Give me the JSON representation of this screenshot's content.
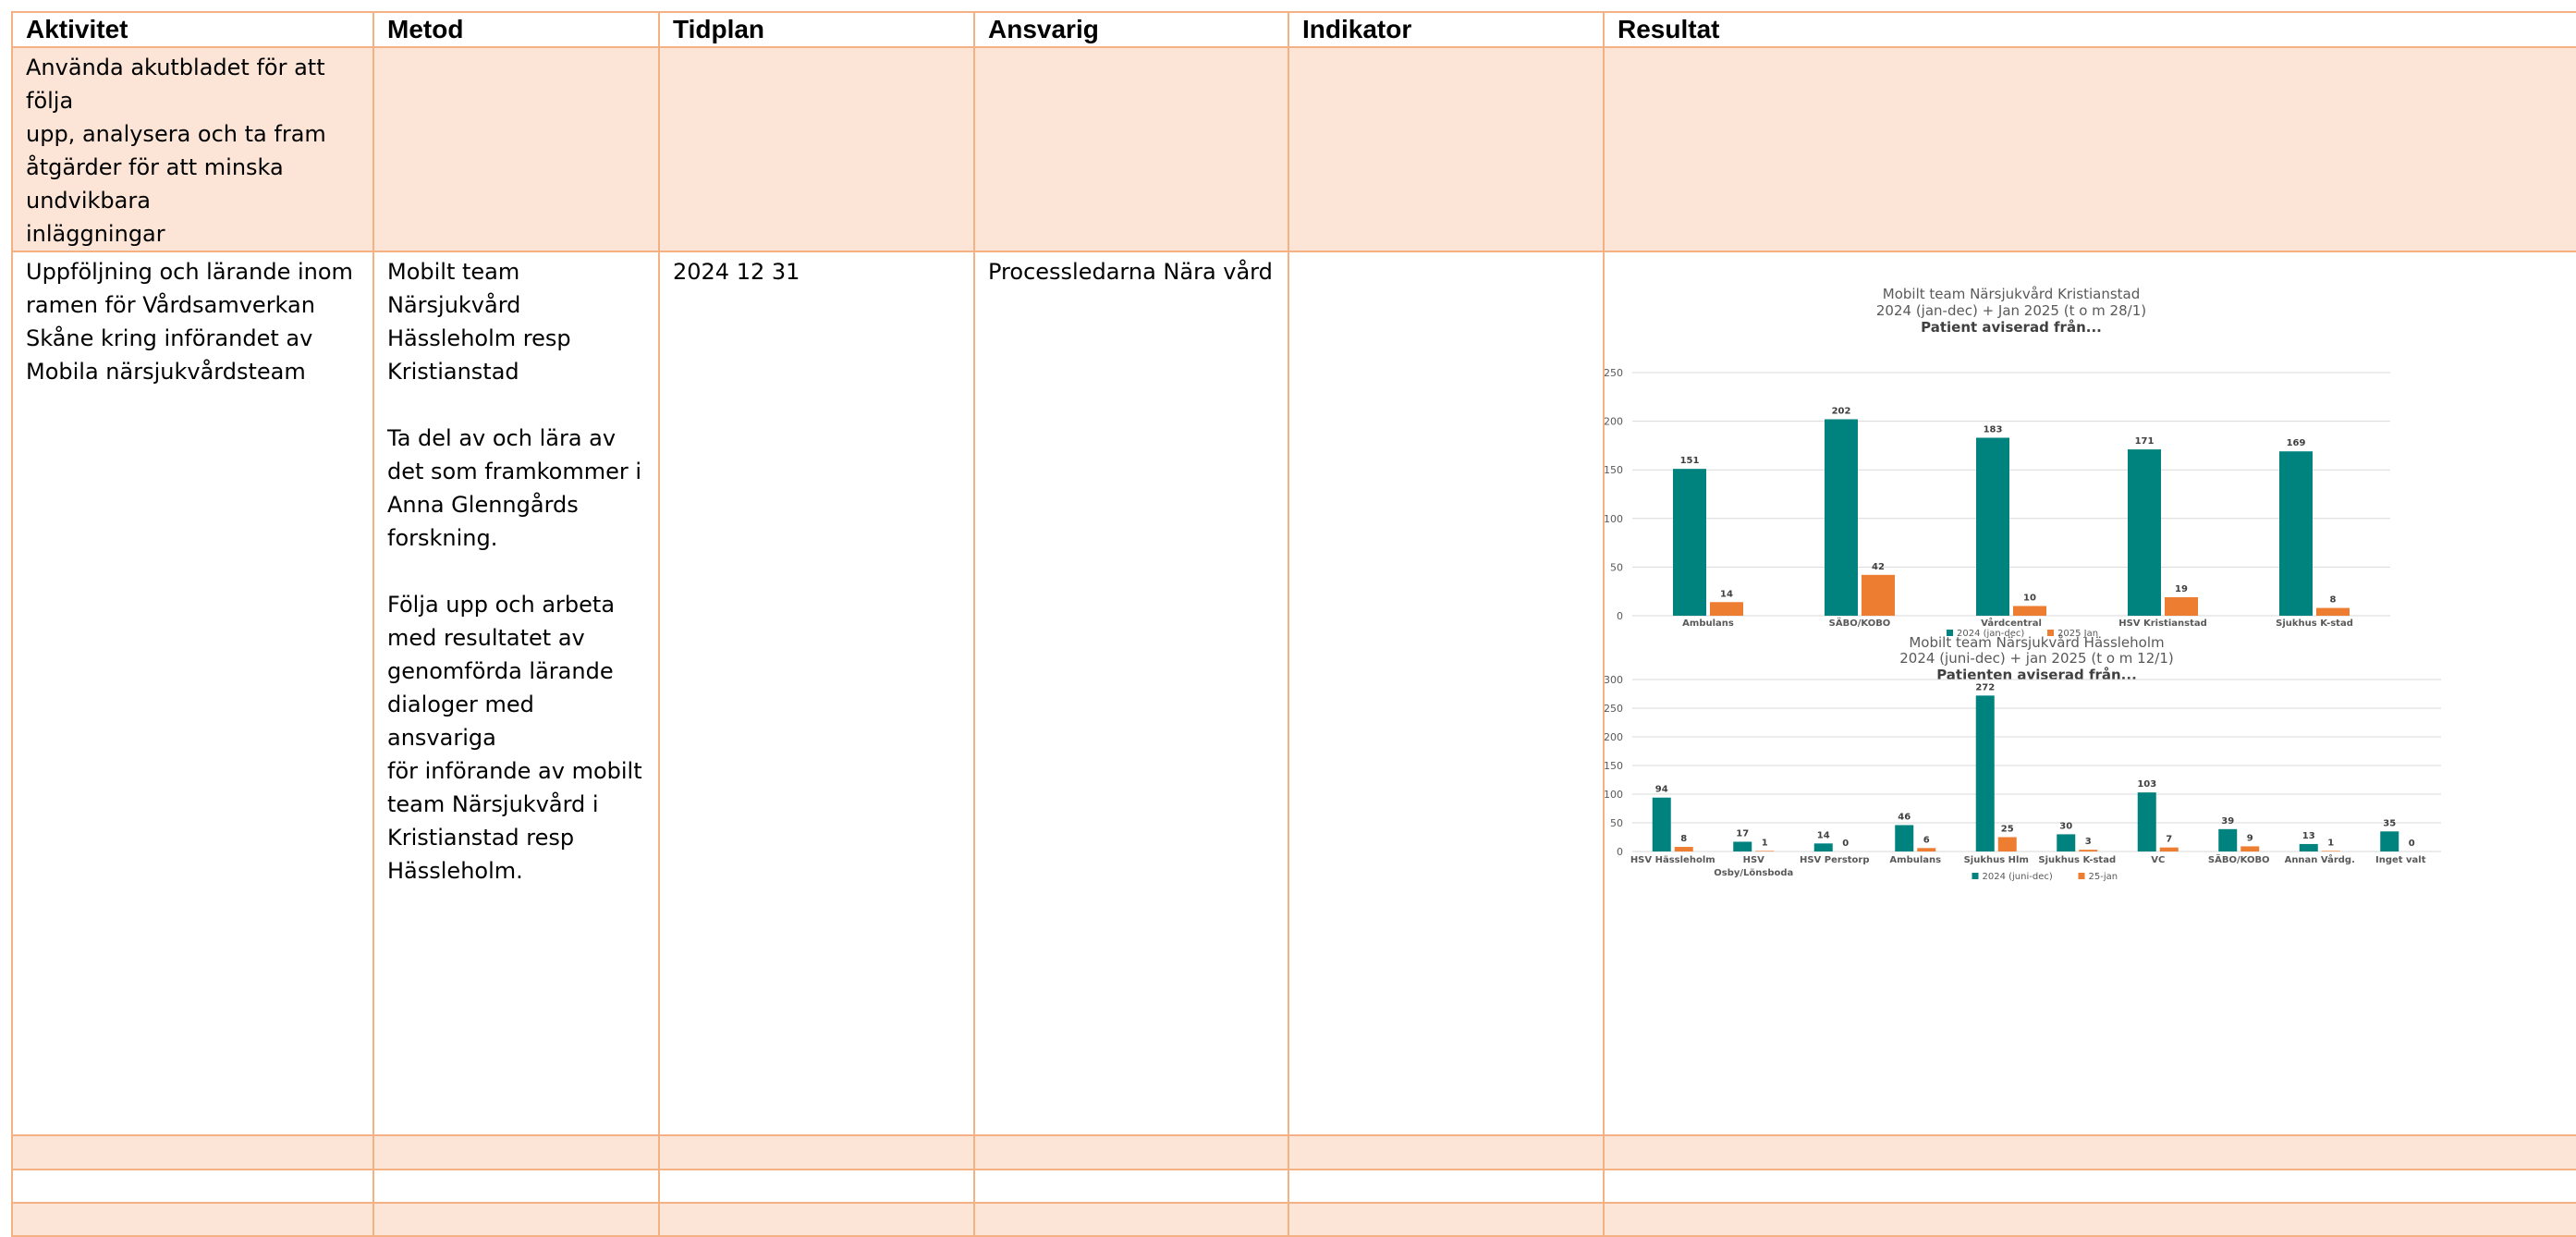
{
  "table": {
    "headers": [
      "Aktivitet",
      "Metod",
      "Tidplan",
      "Ansvarig",
      "Indikator",
      "Resultat"
    ],
    "row1": {
      "aktivitet": "Använda akutbladet för att\nfölja\nupp, analysera och ta fram\nåtgärder för att minska\nundvikbara\ninläggningar"
    },
    "row2": {
      "aktivitet": "Uppföljning och lärande inom\nramen för Vårdsamverkan\nSkåne kring införandet av\nMobila närsjukvårdsteam",
      "metod": "Mobilt team\nNärsjukvård\nHässleholm resp\nKristianstad\n\nTa del av och lära av\ndet som framkommer i\nAnna Glenngårds\nforskning.\n\nFölja upp och arbeta\nmed resultatet av\ngenomförda lärande\ndialoger med ansvariga\nför införande av mobilt\nteam Närsjukvård i\nKristianstad resp\nHässleholm.",
      "tidplan": "2024 12 31",
      "ansvarig": "Processledarna Nära vård",
      "indikator": ""
    }
  },
  "colors": {
    "border": "#f4b183",
    "row_fill": "#fce4d6",
    "series_2024": "#00827f",
    "series_2025": "#ed7d31"
  },
  "chart_data": [
    {
      "type": "bar",
      "title": "Mobilt team Närsjukvård Kristianstad",
      "subtitle": "2024 (jan-dec) + Jan 2025 (t o m 28/1)",
      "subtitle2": "Patient aviserad från...",
      "categories": [
        "Ambulans",
        "SÄBO/KOBO",
        "Vårdcentral",
        "HSV Kristianstad",
        "Sjukhus K-stad"
      ],
      "series": [
        {
          "name": "2024 (jan-dec)",
          "values": [
            151,
            202,
            183,
            171,
            169
          ]
        },
        {
          "name": "2025 Jan",
          "values": [
            14,
            42,
            10,
            19,
            8
          ]
        }
      ],
      "yticks": [
        0,
        50,
        100,
        150,
        200,
        250
      ],
      "ylim": [
        0,
        250
      ],
      "grid": true,
      "legend": "bottom"
    },
    {
      "type": "bar",
      "title": "Mobilt team Närsjukvård Hässleholm",
      "subtitle": "2024 (juni-dec) + jan 2025 (t o m 12/1)",
      "subtitle2": "Patienten aviserad från...",
      "categories": [
        "HSV Hässleholm",
        "HSV\nOsby/Lönsboda",
        "HSV Perstorp",
        "Ambulans",
        "Sjukhus Hlm",
        "Sjukhus K-stad",
        "VC",
        "SÄBO/KOBO",
        "Annan Vårdg.",
        "Inget valt"
      ],
      "series": [
        {
          "name": "2024 (juni-dec)",
          "values": [
            94,
            17,
            14,
            46,
            272,
            30,
            103,
            39,
            13,
            35
          ]
        },
        {
          "name": "25-jan",
          "values": [
            8,
            1,
            0,
            6,
            25,
            3,
            7,
            9,
            1,
            0
          ]
        }
      ],
      "yticks": [
        0,
        50,
        100,
        150,
        200,
        250,
        300
      ],
      "ylim": [
        0,
        300
      ],
      "grid": true,
      "legend": "bottom"
    }
  ]
}
